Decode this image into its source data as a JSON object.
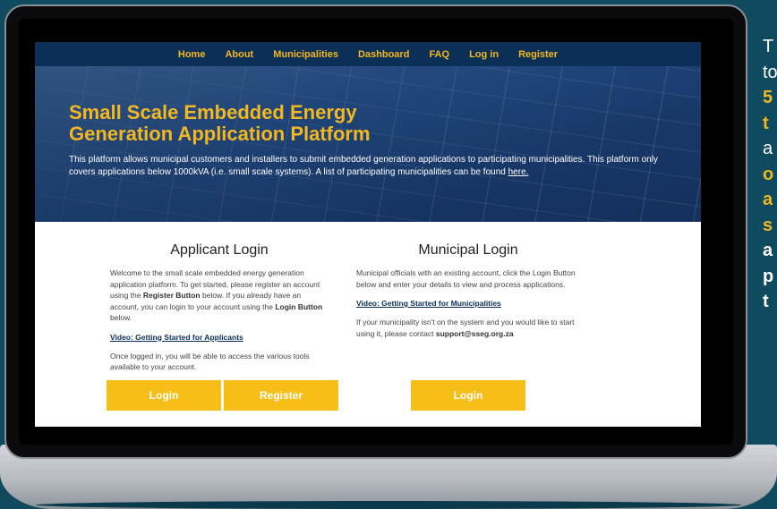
{
  "nav": {
    "items": [
      "Home",
      "About",
      "Municipalities",
      "Dashboard",
      "FAQ",
      "Log in",
      "Register"
    ]
  },
  "hero": {
    "title": "Small Scale Embedded Energy Generation Application Platform",
    "description": "This platform allows municipal customers and installers to submit embedded generation applications to participating municipalities. This platform only covers applications below 1000kVA (i.e. small scale systems). A list of participating municipalities can be found",
    "link_text": "here."
  },
  "applicant": {
    "heading": "Applicant Login",
    "intro_1": "Welcome to the small scale embedded energy generation application platform. To get started, please register an account using the",
    "register_button_ref": "Register Button",
    "intro_2": "below. If you already have an account, you can login to your account using the",
    "login_button_ref": "Login Button",
    "intro_3": "below.",
    "video_link": "Video: Getting Started for Applicants",
    "after_login": "Once logged in, you will be able to access the various tools available to your account.",
    "login_label": "Login",
    "register_label": "Register"
  },
  "municipal": {
    "heading": "Municipal Login",
    "intro": "Municipal officials with an existing account, click the Login Button below and enter your details to view and process applications.",
    "video_link": "Video: Getting Started for Municipalities",
    "contact_text": "If your municipality isn't on the system and you would like to start using it, please contact",
    "contact_email": "support@sseg.org.za",
    "login_label": "Login"
  },
  "side_text": {
    "lines": [
      "T",
      "to",
      "5",
      "t",
      "a",
      "o",
      "a",
      "s",
      "a",
      "p",
      "t"
    ]
  },
  "colors": {
    "accent": "#f7be17",
    "nav_bg": "#0b2f57",
    "page_bg": "#0f4a5e"
  }
}
